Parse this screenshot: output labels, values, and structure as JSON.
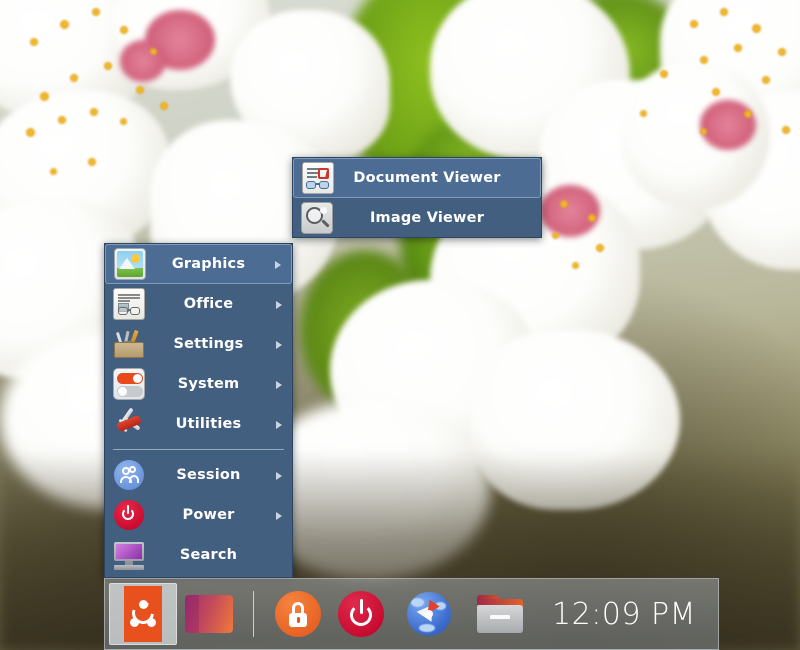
{
  "desktop": {
    "wallpaper_description": "blurred white cherry blossom flowers with yellow stamens and green leaves"
  },
  "main_menu": {
    "items": [
      {
        "label": "Graphics",
        "icon": "graphics-icon",
        "has_submenu": true,
        "selected": true,
        "separator_after": false
      },
      {
        "label": "Office",
        "icon": "office-icon",
        "has_submenu": true,
        "selected": false,
        "separator_after": false
      },
      {
        "label": "Settings",
        "icon": "settings-icon",
        "has_submenu": true,
        "selected": false,
        "separator_after": false
      },
      {
        "label": "System",
        "icon": "system-icon",
        "has_submenu": true,
        "selected": false,
        "separator_after": false
      },
      {
        "label": "Utilities",
        "icon": "utilities-icon",
        "has_submenu": true,
        "selected": false,
        "separator_after": true
      },
      {
        "label": "Session",
        "icon": "session-icon",
        "has_submenu": true,
        "selected": false,
        "separator_after": false
      },
      {
        "label": "Power",
        "icon": "power-icon",
        "has_submenu": true,
        "selected": false,
        "separator_after": false
      },
      {
        "label": "Search",
        "icon": "search-icon",
        "has_submenu": false,
        "selected": false,
        "separator_after": false
      }
    ]
  },
  "sub_menu": {
    "parent": "Graphics",
    "items": [
      {
        "label": "Document Viewer",
        "icon": "document-viewer-icon",
        "selected": true
      },
      {
        "label": "Image Viewer",
        "icon": "image-viewer-icon",
        "selected": false
      }
    ]
  },
  "taskbar": {
    "launcher": {
      "label": "Ubuntu",
      "icon": "ubuntu-logo-icon",
      "active": true
    },
    "workspace": {
      "label": "Workspace 1",
      "icon": "workspace-switcher-icon"
    },
    "buttons": [
      {
        "name": "lock-button",
        "icon": "lock-icon",
        "label": "Lock Screen"
      },
      {
        "name": "power-button",
        "icon": "power-icon",
        "label": "Power Off"
      },
      {
        "name": "browser-button",
        "icon": "browser-compass-icon",
        "label": "Web Browser"
      },
      {
        "name": "files-button",
        "icon": "folder-icon",
        "label": "File Manager"
      }
    ],
    "clock": "12:09 PM"
  },
  "colors": {
    "menu_bg": "#435f7f",
    "menu_selected_bg": "#4c6c93",
    "menu_selected_border": "#7e9bbd",
    "menu_text": "#ffffff",
    "ubuntu_orange": "#e8511d",
    "power_red": "#bd0025",
    "lock_orange": "#e2561a"
  }
}
